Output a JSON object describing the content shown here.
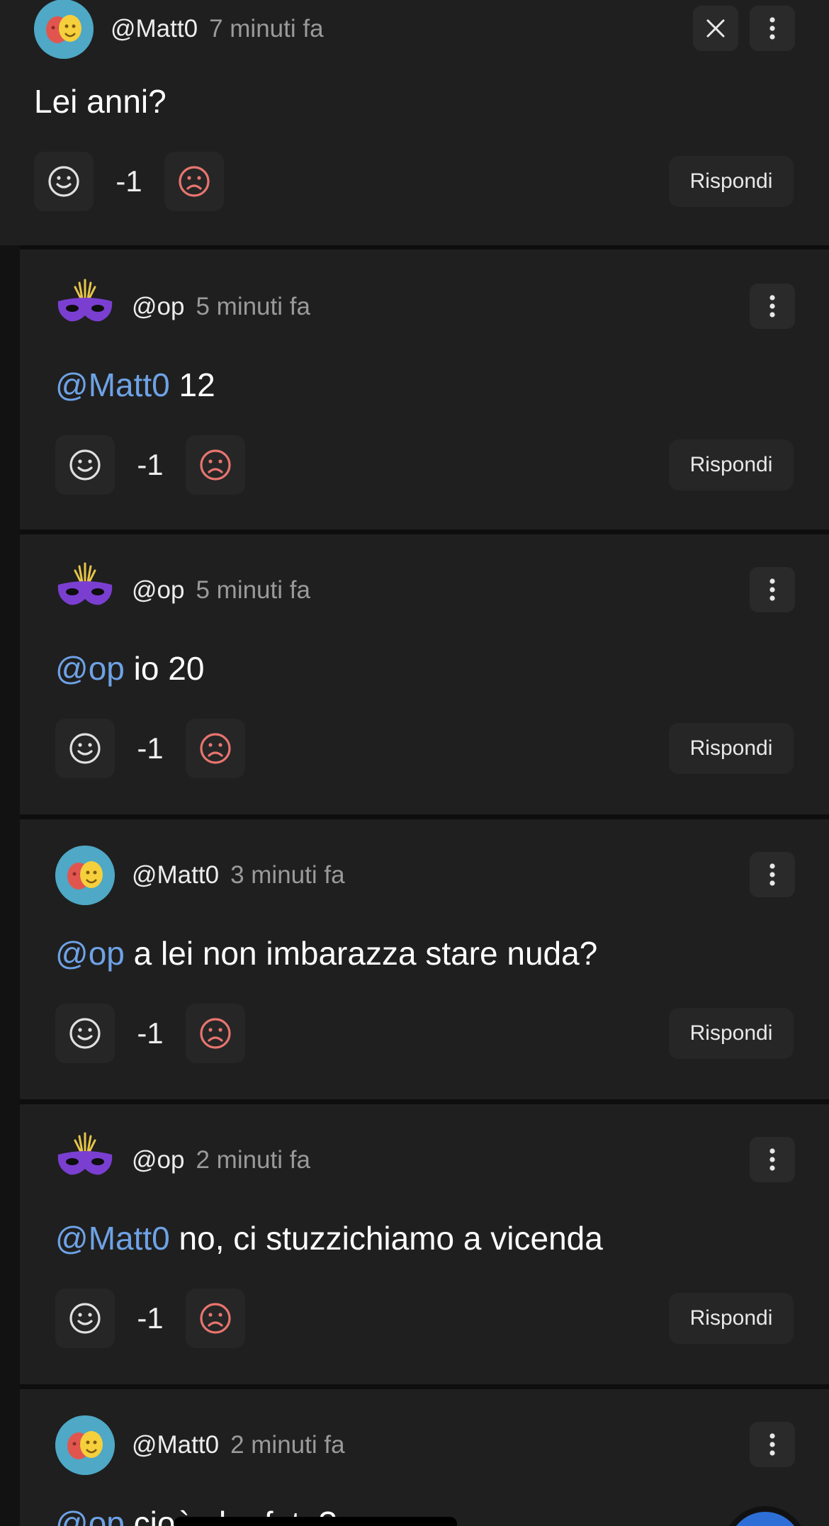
{
  "parent": {
    "username": "@Matt0",
    "time": "7 minuti fa",
    "text": "Lei anni?",
    "score": "-1",
    "reply_label": "Rispondi",
    "avatar_icon": "theater-masks-icon"
  },
  "replies": [
    {
      "username": "@op",
      "time": "5 minuti fa",
      "mention": "@Matt0",
      "text": " 12",
      "score": "-1",
      "reply_label": "Rispondi",
      "avatar_icon": "carnival-mask-icon"
    },
    {
      "username": "@op",
      "time": "5 minuti fa",
      "mention": "@op",
      "text": " io 20",
      "score": "-1",
      "reply_label": "Rispondi",
      "avatar_icon": "carnival-mask-icon"
    },
    {
      "username": "@Matt0",
      "time": "3 minuti fa",
      "mention": "@op",
      "text": " a lei non imbarazza stare nuda?",
      "score": "-1",
      "reply_label": "Rispondi",
      "avatar_icon": "theater-masks-icon"
    },
    {
      "username": "@op",
      "time": "2 minuti fa",
      "mention": "@Matt0",
      "text": " no, ci stuzzichiamo a vicenda",
      "score": "-1",
      "reply_label": "Rispondi",
      "avatar_icon": "carnival-mask-icon"
    },
    {
      "username": "@Matt0",
      "time": "2 minuti fa",
      "mention": "@op",
      "text": " cioè che fate?",
      "score": "",
      "reply_label": "",
      "avatar_icon": "theater-masks-icon"
    }
  ],
  "colors": {
    "mention": "#6ea2e6",
    "downvote": "#e8756f",
    "card_bg": "#1f1f1f",
    "fab": "#2d6fd6"
  }
}
